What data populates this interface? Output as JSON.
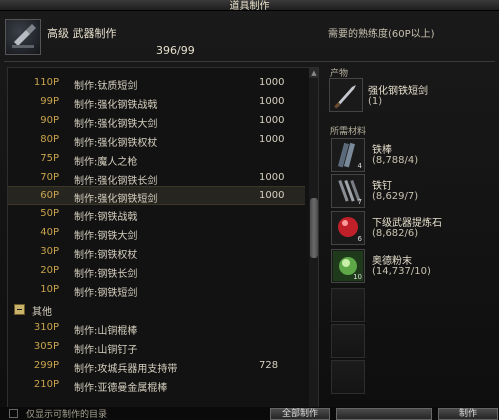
{
  "window": {
    "title": "道具制作"
  },
  "header": {
    "title": "高级 武器制作",
    "count": "396/99",
    "requirement": "需要的熟练度(60P以上)",
    "icon": "anvil-icon"
  },
  "list": {
    "rows": [
      {
        "level": "110P",
        "name": "制作:钛质短剑",
        "qty": "1000"
      },
      {
        "level": "99P",
        "name": "制作:强化钢铁战戟",
        "qty": "1000"
      },
      {
        "level": "90P",
        "name": "制作:强化钢铁大剑",
        "qty": "1000"
      },
      {
        "level": "80P",
        "name": "制作:强化钢铁权杖",
        "qty": "1000"
      },
      {
        "level": "75P",
        "name": "制作:魔人之枪",
        "qty": ""
      },
      {
        "level": "70P",
        "name": "制作:强化钢铁长剑",
        "qty": "1000"
      },
      {
        "level": "60P",
        "name": "制作:强化钢铁短剑",
        "qty": "1000"
      },
      {
        "level": "50P",
        "name": "制作:钢铁战戟",
        "qty": ""
      },
      {
        "level": "40P",
        "name": "制作:钢铁大剑",
        "qty": ""
      },
      {
        "level": "30P",
        "name": "制作:钢铁权杖",
        "qty": ""
      },
      {
        "level": "20P",
        "name": "制作:钢铁长剑",
        "qty": ""
      },
      {
        "level": "10P",
        "name": "制作:钢铁短剑",
        "qty": ""
      }
    ],
    "category": "其他",
    "rows2": [
      {
        "level": "310P",
        "name": "制作:山铜棍棒",
        "qty": ""
      },
      {
        "level": "305P",
        "name": "制作:山铜钉子",
        "qty": ""
      },
      {
        "level": "299P",
        "name": "制作:攻城兵器用支持带",
        "qty": "728"
      },
      {
        "level": "210P",
        "name": "制作:亚德曼金属棍棒",
        "qty": ""
      }
    ]
  },
  "product": {
    "label": "产物",
    "name": "强化钢铁短剑",
    "count": "(1)"
  },
  "materials": {
    "label": "所需材料",
    "items": [
      {
        "name": "铁棒",
        "count": "(8,788/4)",
        "badge": "4",
        "icon": "iron-bar-icon"
      },
      {
        "name": "铁钉",
        "count": "(8,629/7)",
        "badge": "7",
        "icon": "iron-nail-icon"
      },
      {
        "name": "下级武器提炼石",
        "count": "(8,682/6)",
        "badge": "6",
        "icon": "refining-stone-icon"
      },
      {
        "name": "奥德粉末",
        "count": "(14,737/10)",
        "badge": "10",
        "icon": "powder-icon"
      }
    ]
  },
  "footer": {
    "checkbox_label": "仅显示可制作的目录",
    "craft_all": "全部制作",
    "craft": "制作"
  }
}
